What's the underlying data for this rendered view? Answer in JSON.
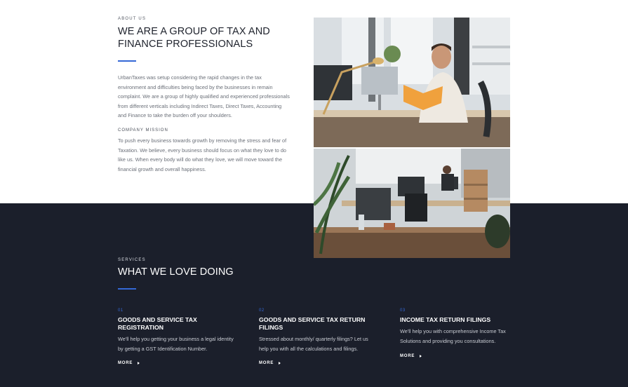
{
  "about": {
    "eyebrow": "ABOUT US",
    "title": "WE ARE A GROUP OF TAX AND FINANCE PROFESSIONALS",
    "paragraph": "UrbanTaxes was setup considering the rapid changes in the tax environment and difficulties being faced by the businesses in remain complaint. We are a group of highly qualified and experienced professionals from different verticals including Indirect Taxes, Direct Taxes, Accounting and Finance to take the burden off your shoulders.",
    "mission_label": "COMPANY MISSION",
    "mission_text": "To push every business towards growth by removing the stress and fear of Taxation. We believe, every business should focus on what they love to do like us. When every body will do what they love, we will move toward the financial growth and overall happiness.",
    "images": [
      {
        "icon": "office-man-reading-photo"
      },
      {
        "icon": "office-workspace-photo"
      }
    ]
  },
  "services": {
    "eyebrow": "SERVICES",
    "title": "WHAT WE LOVE DOING",
    "items": [
      {
        "number": "01",
        "title": "GOODS AND SERVICE TAX REGISTRATION",
        "text": "We'll help you getting your business a legal identity by getting a GST Identification Number.",
        "more": "MORE"
      },
      {
        "number": "02",
        "title": "GOODS AND SERVICE TAX RETURN FILINGS",
        "text": "Stressed about monthly/ quarterly filings? Let us help you with all the calculations and filings.",
        "more": "MORE"
      },
      {
        "number": "03",
        "title": "INCOME TAX RETURN FILINGS",
        "text": "We'll help you with comprehensive Income Tax Solutions and providing you consultations.",
        "more": "MORE"
      }
    ]
  },
  "colors": {
    "accent": "#3468d6",
    "dark_section_bg": "#1b1f2b"
  }
}
